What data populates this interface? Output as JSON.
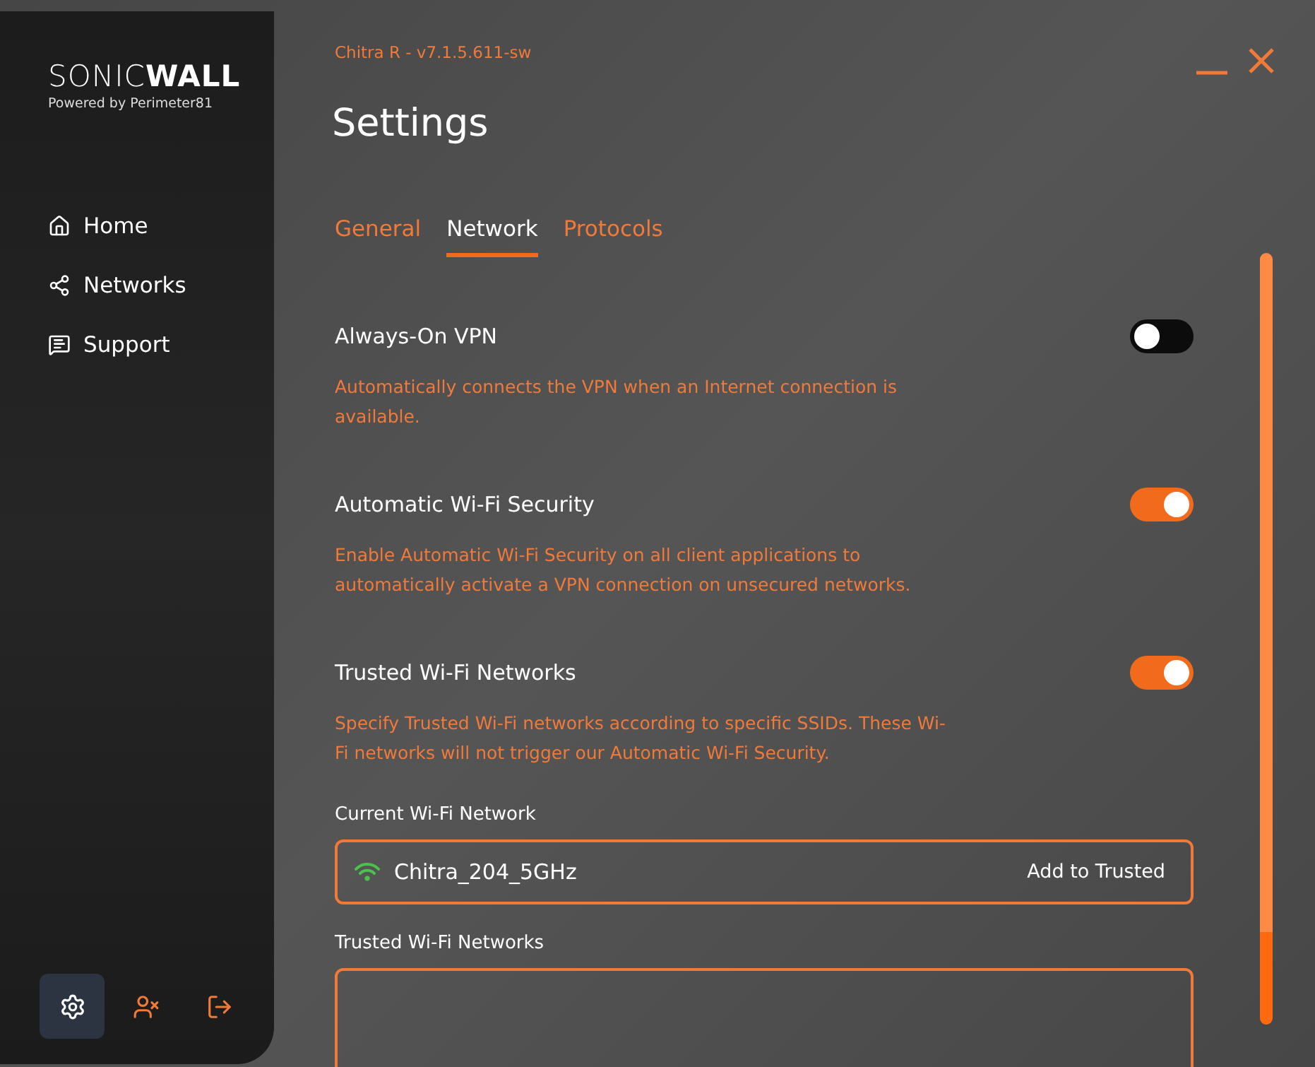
{
  "logo": {
    "wordmark": "SONIC**WALL**",
    "tagline": "Powered by Perimeter81"
  },
  "nav": [
    {
      "kind": "home",
      "label": "Home"
    },
    {
      "kind": "networks",
      "label": "Networks"
    },
    {
      "kind": "support",
      "label": "Support"
    }
  ],
  "bottom_actions": [
    {
      "kind": "settings",
      "selected": true
    },
    {
      "kind": "user-remove",
      "selected": false
    },
    {
      "kind": "logout",
      "selected": false
    }
  ],
  "version": "Chitra R - v7.1.5.611-sw",
  "title": "Settings",
  "tabs": [
    {
      "label": "General",
      "selected": false
    },
    {
      "label": "Network",
      "selected": true
    },
    {
      "label": "Protocols",
      "selected": false
    }
  ],
  "settings": [
    {
      "title": "Always-On VPN",
      "on": false,
      "description": "Automatically connects the VPN when an Internet connection is available."
    },
    {
      "title": "Automatic Wi-Fi Security",
      "on": true,
      "description": "Enable Automatic Wi-Fi Security on all client applications to automatically activate a VPN connection on unsecured networks."
    },
    {
      "title": "Trusted Wi-Fi Networks",
      "on": true,
      "description": "Specify Trusted Wi-Fi networks according to specific SSIDs. These Wi-Fi networks will not trigger our Automatic Wi-Fi Security."
    }
  ],
  "current_network": {
    "label": "Current Wi-Fi Network",
    "ssid": "Chitra_204_5GHz",
    "action": "Add to Trusted"
  },
  "trusted_networks": {
    "label": "Trusted Wi-Fi Networks"
  }
}
